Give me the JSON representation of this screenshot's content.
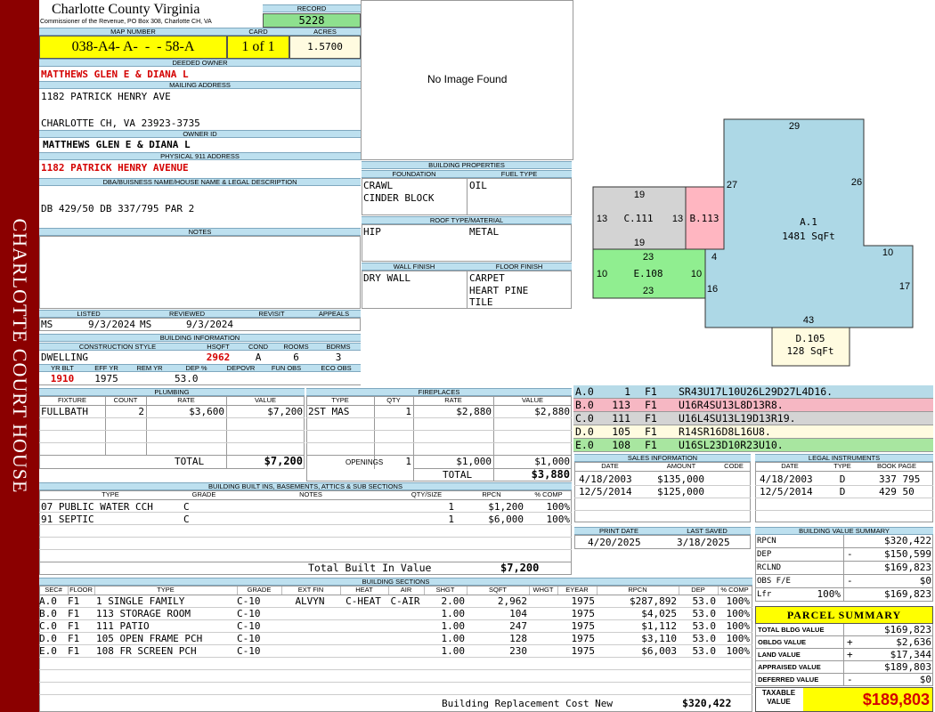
{
  "sidebar": {
    "text": "CHARLOTTE COURT HOUSE"
  },
  "header": {
    "county": "Charlotte County Virginia",
    "commissioner": "Commissioner of the Revenue, PO Box 308, Charlotte CH, VA",
    "record_label": "RECORD",
    "record": "5228",
    "map_label": "MAP NUMBER",
    "map_number": "038-A4- A-  -  - 58-A",
    "card_label": "CARD",
    "card": "1 of 1",
    "acres_label": "ACRES",
    "acres": "1.5700"
  },
  "owner": {
    "deeded_label": "DEEDED OWNER",
    "deeded": "MATTHEWS GLEN E & DIANA L",
    "mailing_label": "MAILING ADDRESS",
    "mail1": "1182 PATRICK HENRY AVE",
    "mail2": "CHARLOTTE CH, VA 23923-3735",
    "ownerid_label": "OWNER ID",
    "ownerid": "MATTHEWS GLEN E & DIANA L",
    "phys_label": "PHYSICAL 911 ADDRESS",
    "phys": "1182 PATRICK HENRY AVENUE",
    "dba_label": "DBA/BUISNESS NAME/HOUSE NAME & LEGAL DESCRIPTION",
    "legal": "DB 429/50 DB 337/795 PAR 2",
    "notes_label": "NOTES"
  },
  "listing": {
    "listed_label": "LISTED",
    "reviewed_label": "REVIEWED",
    "revisit_label": "REVISIT",
    "appeals_label": "APPEALS",
    "listed_by": "MS",
    "listed_date": "9/3/2024",
    "reviewed_by": "MS",
    "reviewed_date": "9/3/2024"
  },
  "building_info": {
    "title": "BUILDING INFORMATION",
    "style_label": "CONSTRUCTION STYLE",
    "hsqft_label": "HSQFT",
    "cond_label": "COND",
    "rooms_label": "ROOMS",
    "bdrms_label": "BDRMS",
    "style": "DWELLING",
    "hsqft": "2962",
    "cond": "A",
    "rooms": "6",
    "bdrms": "3",
    "yrblt_label": "YR BLT",
    "effyr_label": "EFF YR",
    "remyr_label": "REM YR",
    "dep_label": "DEP %",
    "depovr_label": "DEPOVR",
    "funobs_label": "FUN OBS",
    "ecoobs_label": "ECO OBS",
    "yrblt": "1910",
    "effyr": "1975",
    "dep": "53.0"
  },
  "image": {
    "placeholder": "No Image Found"
  },
  "building_props": {
    "title": "BUILDING PROPERTIES",
    "foundation_label": "FOUNDATION",
    "fuel_label": "FUEL TYPE",
    "foundation": [
      "CRAWL",
      "CINDER BLOCK"
    ],
    "fuel": "OIL",
    "roof_label": "ROOF TYPE/MATERIAL",
    "roof_type": "HIP",
    "roof_mat": "METAL",
    "wall_label": "WALL FINISH",
    "floor_label": "FLOOR FINISH",
    "wall": "DRY WALL",
    "floors": [
      "CARPET",
      "HEART PINE",
      "TILE"
    ]
  },
  "sketch": {
    "areas": [
      {
        "label": "A.1",
        "sub": "1481 SqFt"
      },
      {
        "label": "B.113"
      },
      {
        "label": "C.111"
      },
      {
        "label": "D.105",
        "sub": "128 SqFt"
      },
      {
        "label": "E.108"
      }
    ],
    "dims": [
      "29",
      "26",
      "27",
      "10",
      "17",
      "43",
      "4",
      "16",
      "19",
      "13",
      "13",
      "19",
      "23",
      "10",
      "10",
      "23"
    ]
  },
  "sketch_codes": [
    {
      "sec": "A.0",
      "n": "1",
      "f": "F1",
      "code": "SR43U17L10U26L29D27L4D16.",
      "color": "#b7dbe8"
    },
    {
      "sec": "B.0",
      "n": "113",
      "f": "F1",
      "code": "U16R4SU13L8D13R8.",
      "color": "#f6b7c3"
    },
    {
      "sec": "C.0",
      "n": "111",
      "f": "F1",
      "code": "U16L4SU13L19D13R19.",
      "color": "#d4d4d4"
    },
    {
      "sec": "D.0",
      "n": "105",
      "f": "F1",
      "code": "R14SR16D8L16U8.",
      "color": "#fffbe0"
    },
    {
      "sec": "E.0",
      "n": "108",
      "f": "F1",
      "code": "U16SL23D10R23U10.",
      "color": "#a8e6a0"
    }
  ],
  "plumbing": {
    "title": "PLUMBING",
    "headers": [
      "FIXTURE",
      "COUNT",
      "RATE",
      "VALUE"
    ],
    "rows": [
      {
        "fixture": "FULLBATH",
        "count": "2",
        "rate": "$3,600",
        "value": "$7,200"
      }
    ],
    "total_label": "TOTAL",
    "total": "$7,200"
  },
  "fireplaces": {
    "title": "FIREPLACES",
    "headers": [
      "TYPE",
      "QTY",
      "RATE",
      "VALUE"
    ],
    "rows": [
      {
        "type": "2ST MAS",
        "qty": "1",
        "rate": "$2,880",
        "value": "$2,880"
      }
    ],
    "openings_label": "OPENINGS",
    "openings_qty": "1",
    "openings_rate": "$1,000",
    "openings_value": "$1,000",
    "total_label": "TOTAL",
    "total": "$3,880"
  },
  "sales": {
    "title": "SALES INFORMATION",
    "headers": [
      "DATE",
      "AMOUNT",
      "CODE"
    ],
    "rows": [
      {
        "date": "4/18/2003",
        "amount": "$135,000"
      },
      {
        "date": "12/5/2014",
        "amount": "$125,000"
      }
    ]
  },
  "legal_instruments": {
    "title": "LEGAL INSTRUMENTS",
    "headers": [
      "DATE",
      "TYPE",
      "BOOK PAGE"
    ],
    "rows": [
      {
        "date": "4/18/2003",
        "type": "D",
        "book": "337 795"
      },
      {
        "date": "12/5/2014",
        "type": "D",
        "book": "429 50"
      }
    ]
  },
  "builtins": {
    "title": "BUILDING BUILT INS, BASEMENTS, ATTICS & SUB SECTIONS",
    "headers": [
      "TYPE",
      "GRADE",
      "NOTES",
      "QTY/SIZE",
      "RPCN",
      "% COMP"
    ],
    "rows": [
      {
        "type": "07 PUBLIC WATER CCH",
        "grade": "C",
        "qty": "1",
        "rpcn": "$1,200",
        "comp": "100%"
      },
      {
        "type": "91 SEPTIC",
        "grade": "C",
        "qty": "1",
        "rpcn": "$6,000",
        "comp": "100%"
      }
    ],
    "total_label": "Total Built In Value",
    "total": "$7,200"
  },
  "print": {
    "print_label": "PRINT DATE",
    "saved_label": "LAST SAVED",
    "print_date": "4/20/2025",
    "saved_date": "3/18/2025"
  },
  "sections": {
    "title": "BUILDING SECTIONS",
    "headers": [
      "SEC#",
      "FLOOR",
      "TYPE",
      "GRADE",
      "EXT FIN",
      "HEAT",
      "AIR",
      "SHGT",
      "SQFT",
      "WHGT",
      "EYEAR",
      "RPCN",
      "DEP",
      "% COMP"
    ],
    "rows": [
      {
        "sec": "A.0",
        "floor": "F1",
        "type": "1 SINGLE FAMILY",
        "grade": "C-10",
        "ext": "ALVYN",
        "heat": "C-HEAT",
        "air": "C-AIR",
        "shgt": "2.00",
        "sqft": "2,962",
        "eyear": "1975",
        "rpcn": "$287,892",
        "dep": "53.0",
        "comp": "100%"
      },
      {
        "sec": "B.0",
        "floor": "F1",
        "type": "113 STORAGE ROOM",
        "grade": "C-10",
        "ext": "",
        "heat": "",
        "air": "",
        "shgt": "1.00",
        "sqft": "104",
        "eyear": "1975",
        "rpcn": "$4,025",
        "dep": "53.0",
        "comp": "100%"
      },
      {
        "sec": "C.0",
        "floor": "F1",
        "type": "111 PATIO",
        "grade": "C-10",
        "ext": "",
        "heat": "",
        "air": "",
        "shgt": "1.00",
        "sqft": "247",
        "eyear": "1975",
        "rpcn": "$1,112",
        "dep": "53.0",
        "comp": "100%"
      },
      {
        "sec": "D.0",
        "floor": "F1",
        "type": "105 OPEN FRAME PCH",
        "grade": "C-10",
        "ext": "",
        "heat": "",
        "air": "",
        "shgt": "1.00",
        "sqft": "128",
        "eyear": "1975",
        "rpcn": "$3,110",
        "dep": "53.0",
        "comp": "100%"
      },
      {
        "sec": "E.0",
        "floor": "F1",
        "type": "108 FR SCREEN PCH",
        "grade": "C-10",
        "ext": "",
        "heat": "",
        "air": "",
        "shgt": "1.00",
        "sqft": "230",
        "eyear": "1975",
        "rpcn": "$6,003",
        "dep": "53.0",
        "comp": "100%"
      }
    ],
    "replacement_label": "Building Replacement Cost New",
    "replacement": "$320,422"
  },
  "value_summary": {
    "title": "BUILDING VALUE SUMMARY",
    "rows": [
      {
        "label": "RPCN",
        "sign": "",
        "value": "$320,422"
      },
      {
        "label": "DEP",
        "sign": "-",
        "value": "$150,599"
      },
      {
        "label": "RCLND",
        "sign": "",
        "value": "$169,823"
      },
      {
        "label": "OBS F/E",
        "sign": "-",
        "value": "$0"
      },
      {
        "label": "Lfr",
        "pct": "100%",
        "sign": "",
        "value": "$169,823"
      }
    ]
  },
  "parcel": {
    "title": "PARCEL SUMMARY",
    "rows": [
      {
        "label": "TOTAL BLDG VALUE",
        "sign": "",
        "value": "$169,823"
      },
      {
        "label": "OBLDG VALUE",
        "sign": "+",
        "value": "$2,636"
      },
      {
        "label": "LAND VALUE",
        "sign": "+",
        "value": "$17,344"
      },
      {
        "label": "APPRAISED VALUE",
        "sign": "",
        "value": "$189,803"
      },
      {
        "label": "DEFERRED VALUE",
        "sign": "-",
        "value": "$0"
      }
    ],
    "taxable_label": "TAXABLE VALUE",
    "taxable": "$189,803"
  }
}
